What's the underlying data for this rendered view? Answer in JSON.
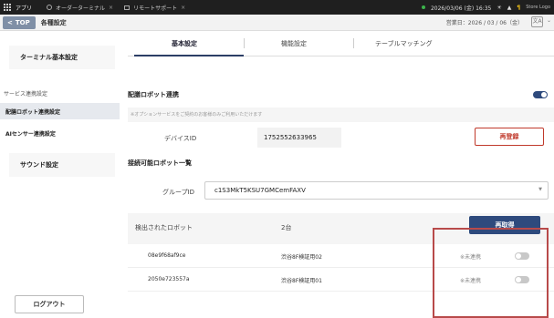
{
  "system_bar": {
    "app_label": "アプリ",
    "tabs": [
      {
        "label": "オーダーターミナル",
        "close": "×"
      },
      {
        "label": "リモートサポート",
        "close": "×"
      }
    ],
    "datetime": "2026/03/06 (金) 16:35",
    "right_small": "Store Logo"
  },
  "header": {
    "top_button": "TOP",
    "title": "各種設定",
    "business_date": "営業日：2026 / 03 / 06（金）",
    "translate_icon": "文A"
  },
  "sidebar": {
    "terminal_settings": "ターミナル基本設定",
    "service_section": "サービス連携設定",
    "sub_items": [
      {
        "label": "配膳ロボット連携設定",
        "active": true
      },
      {
        "label": "AIセンサー連携設定",
        "active": false
      }
    ],
    "sound_settings": "サウンド設定",
    "logout": "ログアウト"
  },
  "tabs": [
    {
      "label": "基本設定",
      "active": true
    },
    {
      "label": "機能設定",
      "active": false
    },
    {
      "label": "テーブルマッチング",
      "active": false
    }
  ],
  "robot_link": {
    "title": "配膳ロボット連携",
    "toggle_on": true,
    "note": "※オプションサービスをご契約のお客様のみご利用いただけます",
    "device_id_label": "デバイスID",
    "device_id_value": "1752552633965",
    "reregister_button": "再登録"
  },
  "connectable": {
    "title": "接続可能ロボット一覧",
    "group_id_label": "グループID",
    "group_id_value": "c1S3MkT5KSU7GMCemFAXV",
    "detected_label": "検出されたロボット",
    "detected_count": "2台",
    "reget_button": "再取得",
    "robots": [
      {
        "id": "08e9f68af9ce",
        "name": "渋谷8F検証用02",
        "status": "未連携",
        "linked": false
      },
      {
        "id": "2050e723557a",
        "name": "渋谷8F検証用01",
        "status": "未連携",
        "linked": false
      }
    ]
  },
  "colors": {
    "accent_navy": "#2e4a7d",
    "danger": "#c0392b",
    "highlight_box": "#b84a4a"
  }
}
